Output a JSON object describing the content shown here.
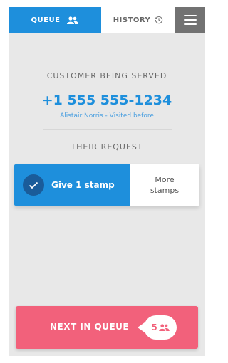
{
  "nav": {
    "queue_label": "QUEUE",
    "history_label": "HISTORY",
    "menu_icon": "hamburger-menu-icon"
  },
  "serving": {
    "caption": "CUSTOMER BEING SERVED",
    "phone": "+1 555 555-1234",
    "customer_info": "Alistair Norris - Visited before"
  },
  "request": {
    "caption": "THEIR REQUEST",
    "primary_option": "Give 1 stamp",
    "secondary_option_line1": "More",
    "secondary_option_line2": "stamps"
  },
  "footer": {
    "next_label": "NEXT IN QUEUE",
    "queue_count": "5"
  },
  "colors": {
    "accent_blue": "#1e8fdc",
    "accent_pink": "#f2617b",
    "background": "#e8e8e8",
    "menu_gray": "#727272"
  }
}
